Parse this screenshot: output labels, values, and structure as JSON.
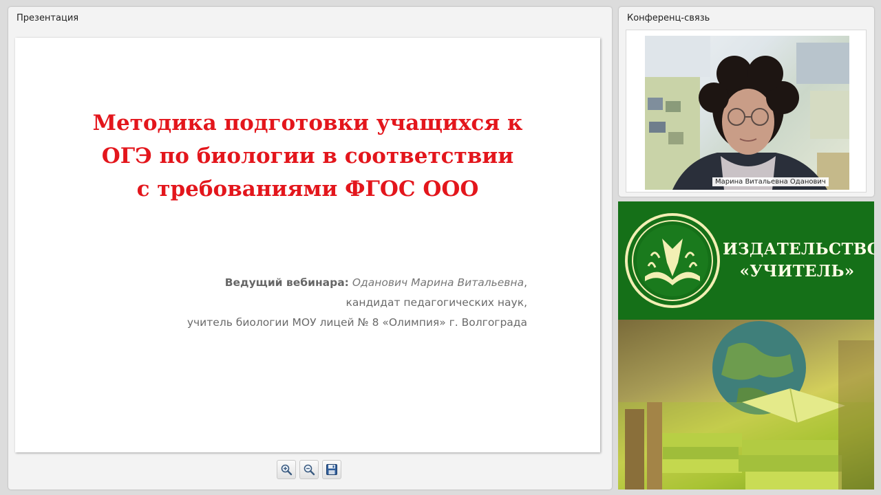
{
  "presentation_panel": {
    "title": "Презентация",
    "slide": {
      "title_lines": [
        "Методика подготовки учащихся к",
        "ОГЭ по биологии в соответствии",
        "с требованиями ФГОС ООО"
      ],
      "presenter_label": "Ведущий вебинара:",
      "presenter_name": "Оданович Марина Витальевна",
      "presenter_name_suffix": ",",
      "presenter_degree": "кандидат педагогических наук,",
      "presenter_job": "учитель биологии МОУ лицей № 8 «Олимпия» г. Волгограда"
    },
    "toolbar": {
      "zoom_in_icon": "zoom-in-icon",
      "zoom_out_icon": "zoom-out-icon",
      "save_icon": "save-icon"
    }
  },
  "conference_panel": {
    "title": "Конференц-связь",
    "participant_name": "Марина Витальевна Оданович"
  },
  "banner": {
    "line1": "ИЗДАТЕЛЬСТВО",
    "line2": "«УЧИТЕЛЬ»",
    "brand_green": "#157018",
    "text_color": "#fffde6"
  },
  "colors": {
    "slide_title": "#e3161c",
    "background": "#dcdcdc"
  }
}
